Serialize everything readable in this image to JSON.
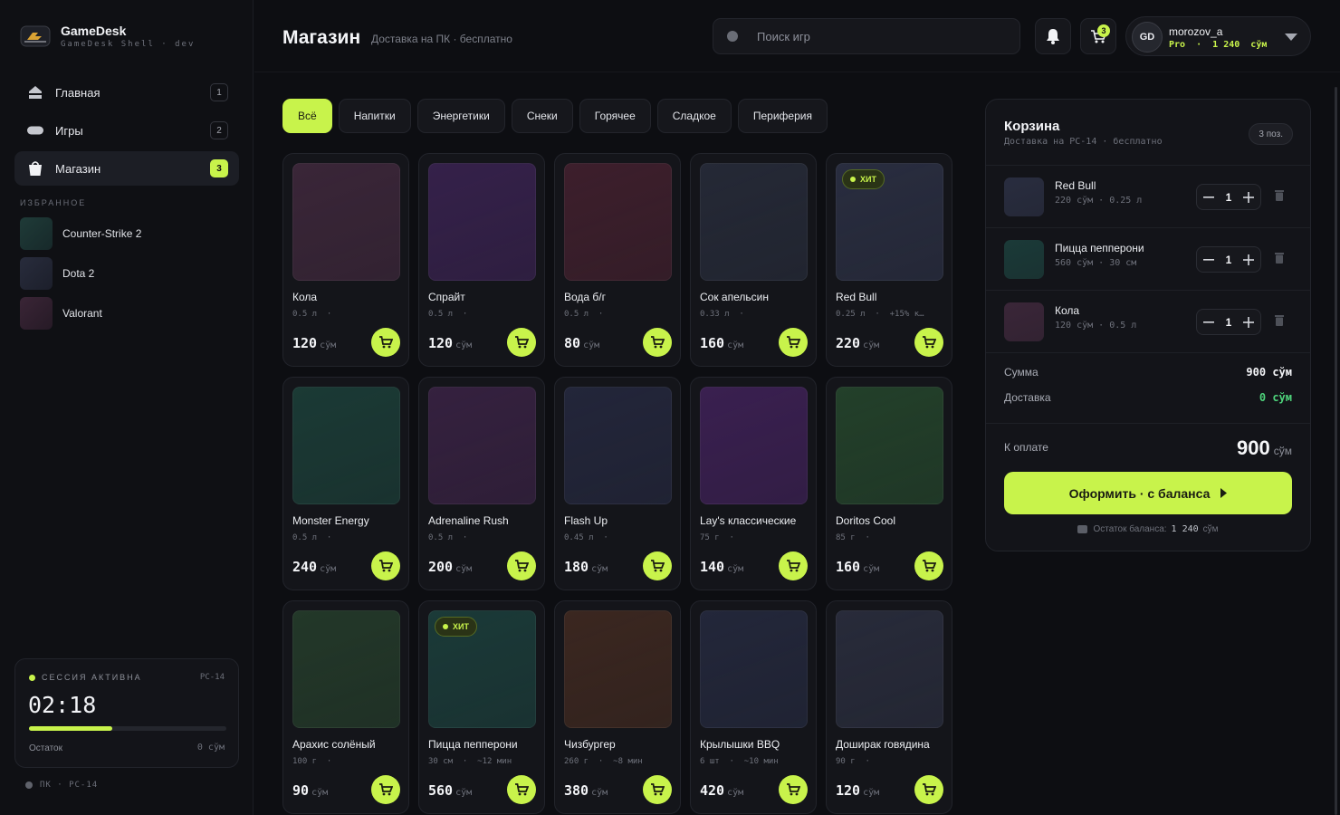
{
  "brand": {
    "name": "GameDesk",
    "subtitle": "GameDesk Shell · dev"
  },
  "nav": [
    {
      "label": "Главная",
      "count": "1",
      "icon": "home-icon",
      "active": false
    },
    {
      "label": "Игры",
      "count": "2",
      "icon": "gamepad-icon",
      "active": false
    },
    {
      "label": "Магазин",
      "count": "3",
      "icon": "shopping-bag-icon",
      "active": true
    }
  ],
  "favorites": {
    "title": "ИЗБРАННОЕ",
    "items": [
      {
        "label": "Counter-Strike 2",
        "color": "#1c3532"
      },
      {
        "label": "Dota 2",
        "color": "#232737"
      },
      {
        "label": "Valorant",
        "color": "#352231"
      }
    ]
  },
  "session": {
    "status": "СЕССИЯ АКТИВНА",
    "pc": "PC-14",
    "time": "02:18",
    "progress": 0.42,
    "rest_label": "Остаток",
    "rest_value": "0 сўм"
  },
  "pc_line": "ПК · PC-14",
  "header": {
    "title": "Магазин",
    "subtitle": "Доставка на ПК · бесплатно",
    "search_placeholder": "Поиск игр",
    "cart_badge": "3",
    "user": {
      "initials": "GD",
      "name": "morozov_a",
      "meta": "Pro  ·  1 240  сўм"
    }
  },
  "categories": [
    "Всё",
    "Напитки",
    "Энергетики",
    "Снеки",
    "Горячее",
    "Сладкое",
    "Периферия"
  ],
  "currency": "сўм",
  "products": [
    {
      "name": "Кола",
      "meta": "0.5 л  ·",
      "price": "120",
      "color": "#3a2638",
      "badge": ""
    },
    {
      "name": "Спрайт",
      "meta": "0.5 л  ·",
      "price": "120",
      "color": "#35214a",
      "badge": ""
    },
    {
      "name": "Вода б/г",
      "meta": "0.5 л  ·",
      "price": "80",
      "color": "#3d1f2c",
      "badge": ""
    },
    {
      "name": "Сок апельсин",
      "meta": "0.33 л  ·",
      "price": "160",
      "color": "#252936",
      "badge": ""
    },
    {
      "name": "Red Bull",
      "meta": "0.25 л  ·  +15% к…",
      "price": "220",
      "color": "#292d3f",
      "badge": "ХИТ"
    },
    {
      "name": "Monster Energy",
      "meta": "0.5 л  ·",
      "price": "240",
      "color": "#1b3a35",
      "badge": ""
    },
    {
      "name": "Adrenaline Rush",
      "meta": "0.5 л  ·",
      "price": "200",
      "color": "#35213f",
      "badge": ""
    },
    {
      "name": "Flash Up",
      "meta": "0.45 л  ·",
      "price": "180",
      "color": "#23263a",
      "badge": ""
    },
    {
      "name": "Lay's классические",
      "meta": "75 г  ·",
      "price": "140",
      "color": "#3a2050",
      "badge": ""
    },
    {
      "name": "Doritos Cool",
      "meta": "85 г  ·",
      "price": "160",
      "color": "#23402a",
      "badge": ""
    },
    {
      "name": "Арахис солёный",
      "meta": "100 г  ·",
      "price": "90",
      "color": "#233829",
      "badge": ""
    },
    {
      "name": "Пицца пепперони",
      "meta": "30 см  ·  ~12 мин",
      "price": "560",
      "color": "#1b3a38",
      "badge": "ХИТ"
    },
    {
      "name": "Чизбургер",
      "meta": "260 г  ·  ~8 мин",
      "price": "380",
      "color": "#3b2720",
      "badge": ""
    },
    {
      "name": "Крылышки BBQ",
      "meta": "6 шт  ·  ~10 мин",
      "price": "420",
      "color": "#23273a",
      "badge": ""
    },
    {
      "name": "Доширак говядина",
      "meta": "90 г  ·",
      "price": "120",
      "color": "#282b3a",
      "badge": ""
    }
  ],
  "cart": {
    "title": "Корзина",
    "subtitle": "Доставка на PC-14 · бесплатно",
    "count": "3 поз.",
    "items": [
      {
        "name": "Red Bull",
        "meta": "220 сўм · 0.25 л",
        "qty": "1",
        "color": "#292d3f"
      },
      {
        "name": "Пицца пепперони",
        "meta": "560 сўм · 30 см",
        "qty": "1",
        "color": "#1b3a38"
      },
      {
        "name": "Кола",
        "meta": "120 сўм · 0.5 л",
        "qty": "1",
        "color": "#3a2638"
      }
    ],
    "sum_label": "Сумма",
    "sum_value": "900 сўм",
    "delivery_label": "Доставка",
    "delivery_value": "0 сўм",
    "total_label": "К оплате",
    "total_value": "900",
    "total_currency": "сўм",
    "checkout_label": "Оформить · с баланса",
    "balance_label": "Остаток баланса:",
    "balance_value": "1 240",
    "balance_currency": "сўм"
  },
  "colors": {
    "accent": "#c8f34b",
    "background": "#0d0e12",
    "success": "#4ed37b"
  }
}
